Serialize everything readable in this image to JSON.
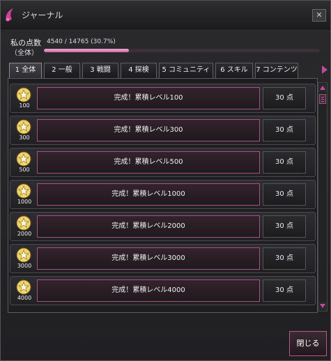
{
  "window": {
    "title": "ジャーナル",
    "close_glyph": "✕"
  },
  "score": {
    "label_line1": "私の点数",
    "label_line2": "（全体）",
    "value": "4540 / 14765 (30.7%)",
    "progress": 0.307
  },
  "tabs": [
    {
      "label": "1 全体",
      "active": true
    },
    {
      "label": "2 一般",
      "active": false
    },
    {
      "label": "3 戦闘",
      "active": false
    },
    {
      "label": "4 探検",
      "active": false
    },
    {
      "label": "5 コミュニティ",
      "active": false
    },
    {
      "label": "6 スキル",
      "active": false
    },
    {
      "label": "7 コンテンツ",
      "active": false
    }
  ],
  "achievements": [
    {
      "badge": "100",
      "name": "完成！累積レベル100",
      "points": "30 点"
    },
    {
      "badge": "300",
      "name": "完成！累積レベル300",
      "points": "30 点"
    },
    {
      "badge": "500",
      "name": "完成！累積レベル500",
      "points": "30 点"
    },
    {
      "badge": "1000",
      "name": "完成！累積レベル1000",
      "points": "30 点"
    },
    {
      "badge": "2000",
      "name": "完成！累積レベル2000",
      "points": "30 点"
    },
    {
      "badge": "3000",
      "name": "完成！累積レベル3000",
      "points": "30 点"
    },
    {
      "badge": "4000",
      "name": "完成！累積レベル4000",
      "points": "30 点"
    }
  ],
  "footer": {
    "close_label": "閉じる"
  },
  "colors": {
    "accent": "#c04a9c",
    "progress_fill": "#e79bc8",
    "badge_gold": "#e6c14a"
  }
}
